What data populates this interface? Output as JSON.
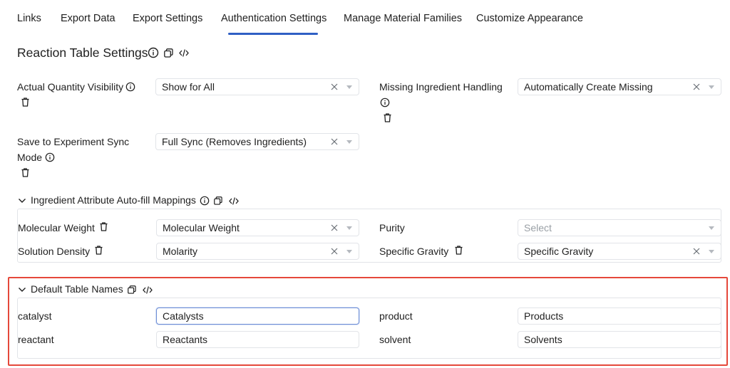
{
  "tabs": [
    {
      "label": "Links"
    },
    {
      "label": "Export Data"
    },
    {
      "label": "Export Settings"
    },
    {
      "label": "Authentication Settings"
    },
    {
      "label": "Manage Material Families"
    },
    {
      "label": "Customize Appearance"
    }
  ],
  "active_tab": "Authentication Settings",
  "page_title": "Reaction Table Settings",
  "settings": {
    "actual_quantity_visibility": {
      "label": "Actual Quantity Visibility",
      "value": "Show for All"
    },
    "missing_ingredient_handling": {
      "label": "Missing Ingredient Handling",
      "value": "Automatically Create Missing"
    },
    "save_sync_mode": {
      "label_line1": "Save to Experiment Sync",
      "label_line2": "Mode",
      "value": "Full Sync (Removes Ingredients)"
    }
  },
  "autofill": {
    "title": "Ingredient Attribute Auto-fill Mappings",
    "molecular_weight": {
      "label": "Molecular Weight",
      "value": "Molecular Weight"
    },
    "purity": {
      "label": "Purity",
      "placeholder": "Select"
    },
    "solution_density": {
      "label": "Solution Density",
      "value": "Molarity"
    },
    "specific_gravity": {
      "label": "Specific Gravity",
      "value": "Specific Gravity"
    }
  },
  "table_names": {
    "title": "Default Table Names",
    "catalyst": {
      "label": "catalyst",
      "value": "Catalysts"
    },
    "product": {
      "label": "product",
      "value": "Products"
    },
    "reactant": {
      "label": "reactant",
      "value": "Reactants"
    },
    "solvent": {
      "label": "solvent",
      "value": "Solvents"
    }
  },
  "colors": {
    "accent": "#2f5fc4",
    "highlight": "#e5483a",
    "border": "#e2e4e8"
  }
}
